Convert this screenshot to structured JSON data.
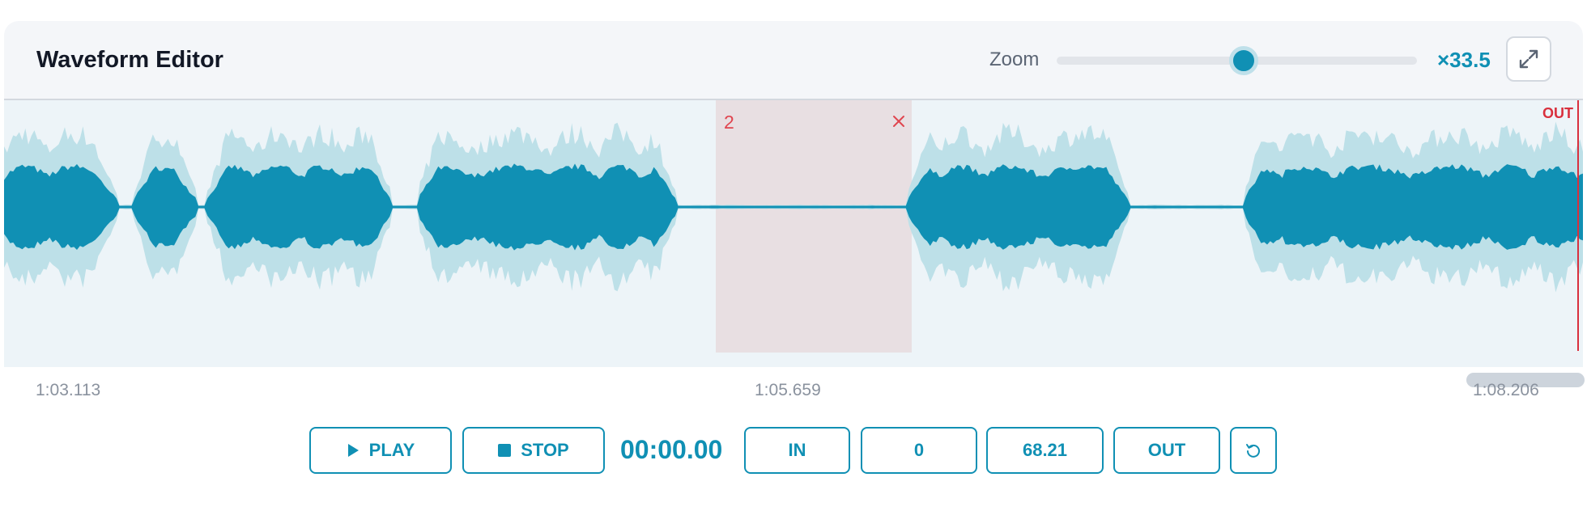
{
  "header": {
    "title": "Waveform Editor",
    "zoom_label": "Zoom",
    "zoom_value": "×33.5",
    "zoom_level_fraction": 0.52
  },
  "waveform": {
    "region_number": "2",
    "out_label": "OUT",
    "colors": {
      "wave_main": "#1090b4",
      "wave_light": "#bde0e8",
      "region_fill": "#e8dfe2",
      "marker": "#d9303d"
    }
  },
  "timeline": {
    "start": "1:03.113",
    "mid": "1:05.659",
    "end": "1:08.206"
  },
  "controls": {
    "play_label": "PLAY",
    "stop_label": "STOP",
    "timecode": "00:00.00",
    "in_label": "IN",
    "in_value": "0",
    "out_value": "68.21",
    "out_label": "OUT"
  },
  "icons": [
    "expand-icon",
    "play-icon",
    "stop-icon",
    "reset-icon",
    "close-icon"
  ]
}
